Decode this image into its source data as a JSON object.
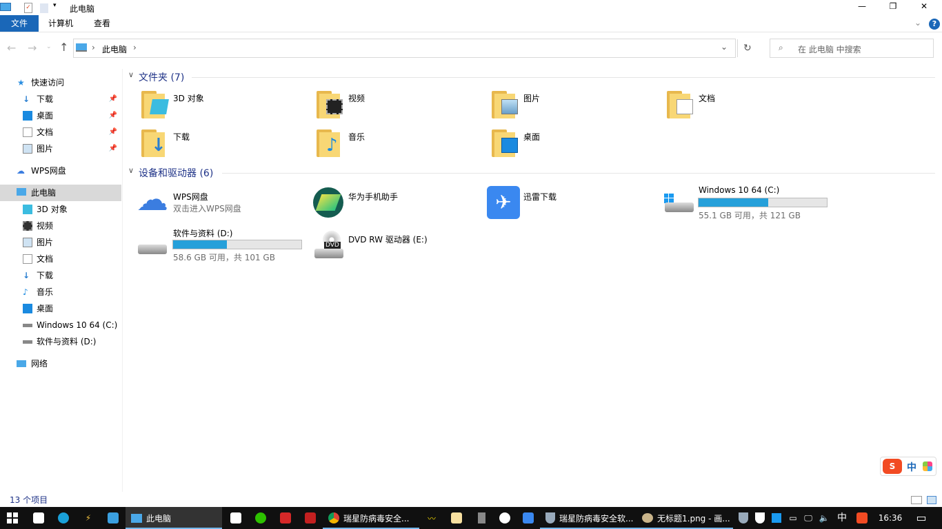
{
  "window": {
    "title": "此电脑",
    "min": "—",
    "max": "❐",
    "close": "✕"
  },
  "ribbon": {
    "tabs": [
      "文件",
      "计算机",
      "查看"
    ],
    "help": "?"
  },
  "address": {
    "path": [
      "此电脑"
    ],
    "refresh": "↻",
    "search_placeholder": "在 此电脑 中搜索"
  },
  "nav": {
    "quick_access": "快速访问",
    "quick_items": [
      "下载",
      "桌面",
      "文档",
      "图片"
    ],
    "wps": "WPS网盘",
    "this_pc": "此电脑",
    "pc_items": [
      "3D 对象",
      "视频",
      "图片",
      "文档",
      "下载",
      "音乐",
      "桌面",
      "Windows 10 64 (C:)",
      "软件与资料 (D:)"
    ],
    "network": "网络"
  },
  "folders": {
    "header": "文件夹 (7)",
    "items": [
      "3D 对象",
      "视频",
      "图片",
      "文档",
      "下载",
      "音乐",
      "桌面"
    ]
  },
  "devices": {
    "header": "设备和驱动器 (6)",
    "wps": {
      "name": "WPS网盘",
      "sub": "双击进入WPS网盘"
    },
    "huawei": "华为手机助手",
    "xunlei": "迅雷下载",
    "c": {
      "name": "Windows 10 64 (C:)",
      "free": "55.1 GB 可用，共 121 GB",
      "used_fraction": 0.545
    },
    "d": {
      "name": "软件与资料 (D:)",
      "free": "58.6 GB 可用，共 101 GB",
      "used_fraction": 0.42
    },
    "dvd": {
      "name": "DVD RW 驱动器 (E:)",
      "badge": "DVD"
    }
  },
  "status": {
    "count": "13 个项目"
  },
  "ime": {
    "label": "中"
  },
  "taskbar": {
    "explorer": "此电脑",
    "chrome": "瑞星防病毒安全...",
    "rising": "瑞星防病毒安全软...",
    "paint": "无标题1.png - 画...",
    "ime": "中",
    "time": "16:36"
  }
}
